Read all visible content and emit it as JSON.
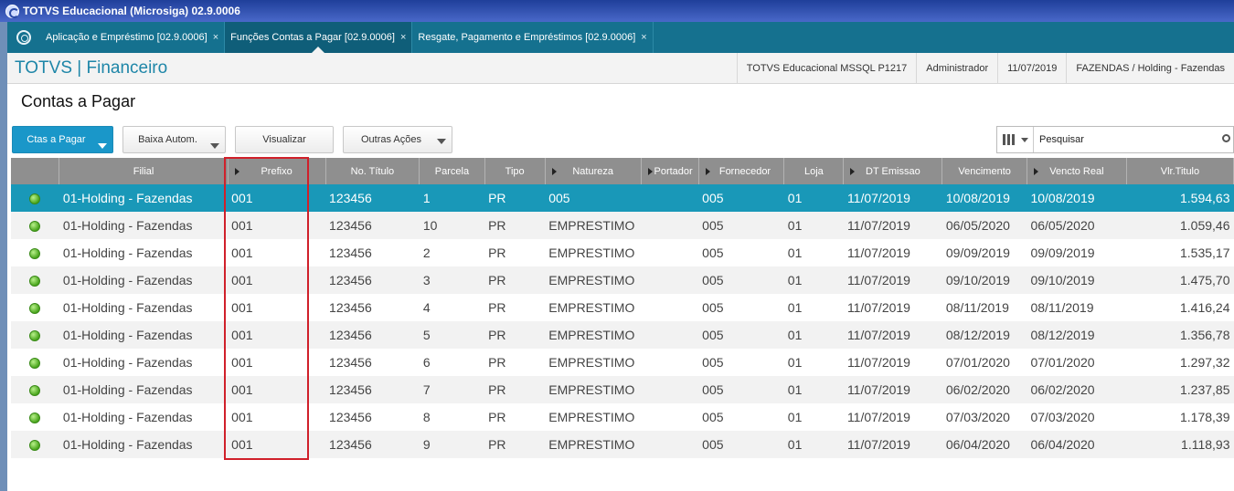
{
  "window": {
    "title": "TOTVS Educacional (Microsiga) 02.9.0006"
  },
  "tabs": [
    {
      "label": "Aplicação e Empréstimo [02.9.0006]",
      "close": "×"
    },
    {
      "label": "Funções Contas a Pagar [02.9.0006]",
      "close": "×",
      "active": true
    },
    {
      "label": "Resgate, Pagamento e Empréstimos [02.9.0006]",
      "close": "×"
    }
  ],
  "header": {
    "brand": "TOTVS | Financeiro",
    "environment": "TOTVS Educacional MSSQL P1217",
    "user": "Administrador",
    "date": "11/07/2019",
    "company": "FAZENDAS / Holding - Fazendas"
  },
  "page": {
    "title": "Contas a Pagar"
  },
  "toolbar": {
    "ctas_label": "Ctas a Pagar",
    "baixa_label": "Baixa Autom.",
    "visualizar_label": "Visualizar",
    "outras_label": "Outras Ações"
  },
  "search": {
    "placeholder": "Pesquisar"
  },
  "grid": {
    "columns": [
      "",
      "Filial",
      "Prefixo",
      "No. Título",
      "Parcela",
      "Tipo",
      "Natureza",
      "Portador",
      "Fornecedor",
      "Loja",
      "DT Emissao",
      "Vencimento",
      "Vencto Real",
      "Vlr.Titulo"
    ],
    "rows": [
      [
        "01-Holding - Fazendas",
        "001",
        "123456",
        "1",
        "PR",
        "005",
        "",
        "005",
        "01",
        "11/07/2019",
        "10/08/2019",
        "10/08/2019",
        "1.594,63"
      ],
      [
        "01-Holding - Fazendas",
        "001",
        "123456",
        "10",
        "PR",
        "EMPRESTIMO",
        "",
        "005",
        "01",
        "11/07/2019",
        "06/05/2020",
        "06/05/2020",
        "1.059,46"
      ],
      [
        "01-Holding - Fazendas",
        "001",
        "123456",
        "2",
        "PR",
        "EMPRESTIMO",
        "",
        "005",
        "01",
        "11/07/2019",
        "09/09/2019",
        "09/09/2019",
        "1.535,17"
      ],
      [
        "01-Holding - Fazendas",
        "001",
        "123456",
        "3",
        "PR",
        "EMPRESTIMO",
        "",
        "005",
        "01",
        "11/07/2019",
        "09/10/2019",
        "09/10/2019",
        "1.475,70"
      ],
      [
        "01-Holding - Fazendas",
        "001",
        "123456",
        "4",
        "PR",
        "EMPRESTIMO",
        "",
        "005",
        "01",
        "11/07/2019",
        "08/11/2019",
        "08/11/2019",
        "1.416,24"
      ],
      [
        "01-Holding - Fazendas",
        "001",
        "123456",
        "5",
        "PR",
        "EMPRESTIMO",
        "",
        "005",
        "01",
        "11/07/2019",
        "08/12/2019",
        "08/12/2019",
        "1.356,78"
      ],
      [
        "01-Holding - Fazendas",
        "001",
        "123456",
        "6",
        "PR",
        "EMPRESTIMO",
        "",
        "005",
        "01",
        "11/07/2019",
        "07/01/2020",
        "07/01/2020",
        "1.297,32"
      ],
      [
        "01-Holding - Fazendas",
        "001",
        "123456",
        "7",
        "PR",
        "EMPRESTIMO",
        "",
        "005",
        "01",
        "11/07/2019",
        "06/02/2020",
        "06/02/2020",
        "1.237,85"
      ],
      [
        "01-Holding - Fazendas",
        "001",
        "123456",
        "8",
        "PR",
        "EMPRESTIMO",
        "",
        "005",
        "01",
        "11/07/2019",
        "07/03/2020",
        "07/03/2020",
        "1.178,39"
      ],
      [
        "01-Holding - Fazendas",
        "001",
        "123456",
        "9",
        "PR",
        "EMPRESTIMO",
        "",
        "005",
        "01",
        "11/07/2019",
        "06/04/2020",
        "06/04/2020",
        "1.118,93"
      ]
    ]
  },
  "colors": {
    "accent": "#1998b8",
    "tabbar": "#15718f",
    "status_open": "#49a51c",
    "highlight": "#d0202a"
  }
}
